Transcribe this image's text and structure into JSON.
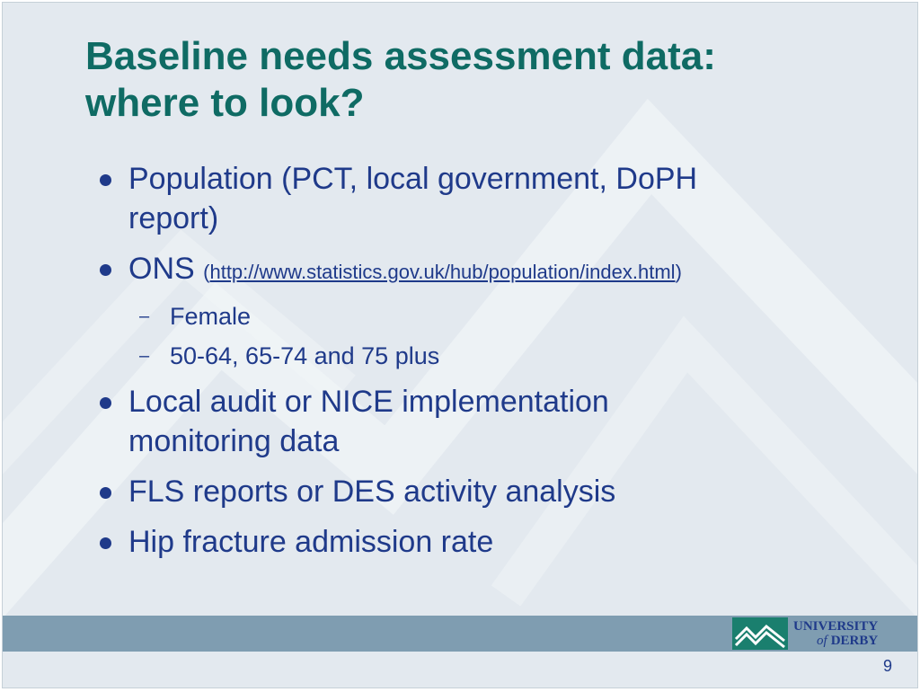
{
  "slide": {
    "title_line1": "Baseline needs assessment data:",
    "title_line2": "where to look?",
    "bullets": [
      {
        "text_line1": "Population (PCT, local government, DoPH",
        "text_line2": "report)"
      },
      {
        "prefix": "ONS",
        "open_paren": "(",
        "link": "http://www.statistics.gov.uk/hub/population/index.html",
        "close_paren": ")"
      },
      {
        "text_line1": "Local audit or NICE implementation",
        "text_line2": "monitoring data"
      },
      {
        "text": "FLS reports or DES activity analysis"
      },
      {
        "text": "Hip fracture admission rate"
      }
    ],
    "sub_bullets": [
      "Female",
      "50-64, 65-74 and 75 plus"
    ],
    "sub_marker": "–",
    "page_number": "9"
  },
  "logo": {
    "line1": "UNIVERSITY",
    "line2_of": "of",
    "line2_name": "DERBY",
    "icon": "mountains-logo-icon"
  },
  "colors": {
    "title": "#0f6b64",
    "text": "#1f3a8a",
    "background": "#e3e9ef",
    "footer_bar": "#7f9db1",
    "logo_green": "#1a7f6e"
  }
}
